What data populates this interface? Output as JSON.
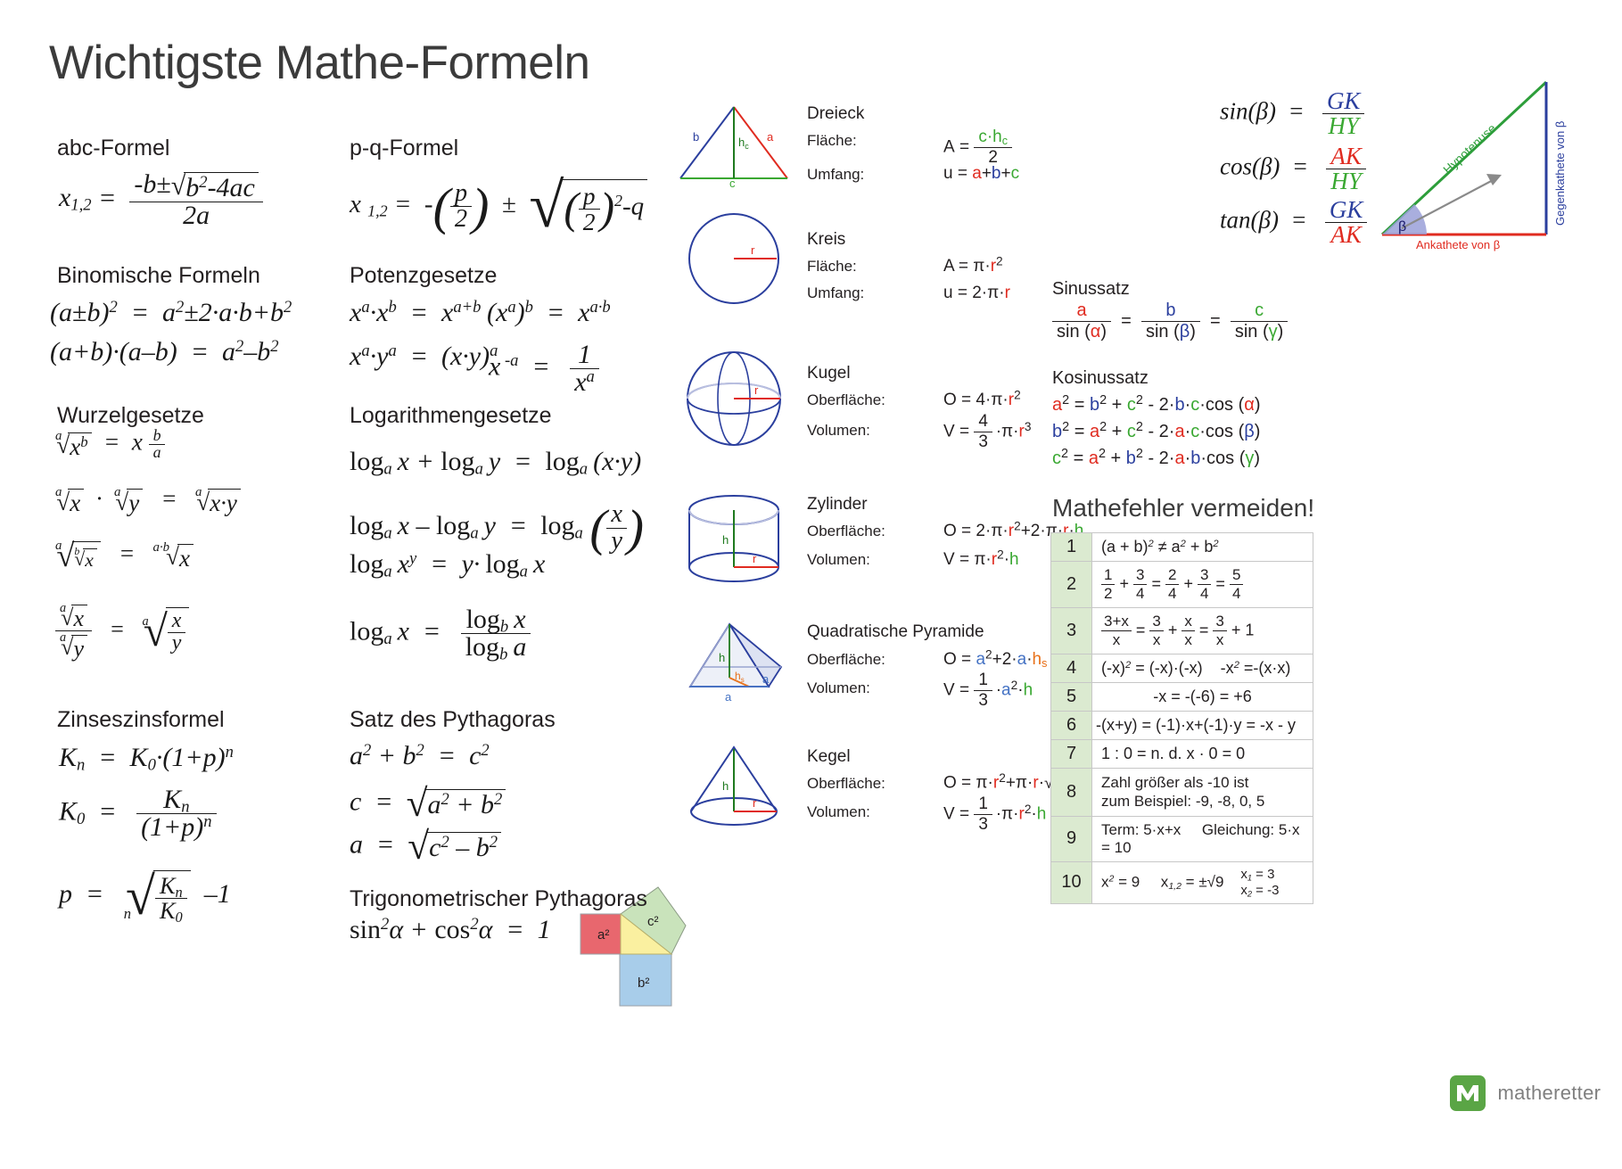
{
  "page": {
    "title": "Wichtigste Mathe-Formeln"
  },
  "sections": {
    "abc": {
      "heading": "abc-Formel"
    },
    "pq": {
      "heading": "p-q-Formel"
    },
    "binom": {
      "heading": "Binomische Formeln"
    },
    "potenz": {
      "heading": "Potenzgesetze"
    },
    "wurzel": {
      "heading": "Wurzelgesetze"
    },
    "log": {
      "heading": "Logarithmengesetze"
    },
    "zins": {
      "heading": "Zinseszinsformel"
    },
    "pyth": {
      "heading": "Satz des Pythagoras"
    },
    "trigpyth": {
      "heading": "Trigonometrischer Pythagoras"
    },
    "sinussatz": {
      "heading": "Sinussatz"
    },
    "kosinussatz": {
      "heading": "Kosinussatz"
    },
    "fehler": {
      "heading": "Mathefehler vermeiden!"
    }
  },
  "pythagoras_diagram": {
    "a_label": "a²",
    "b_label": "b²",
    "c_label": "c²",
    "colors": {
      "a": "#e8676e",
      "b": "#a8cdea",
      "c": "#c9e3bb",
      "triangle": "#faf0a0"
    }
  },
  "shapes": [
    {
      "name": "Dreieck",
      "rows": [
        {
          "label": "Fläche:",
          "lhs": "A"
        },
        {
          "label": "Umfang:",
          "lhs": "u"
        }
      ],
      "diagram_labels": {
        "a": "a",
        "b": "b",
        "c": "c",
        "h": "h",
        "h_sub": "c"
      }
    },
    {
      "name": "Kreis",
      "rows": [
        {
          "label": "Fläche:",
          "lhs": "A"
        },
        {
          "label": "Umfang:",
          "lhs": "u"
        }
      ],
      "diagram_labels": {
        "r": "r"
      }
    },
    {
      "name": "Kugel",
      "rows": [
        {
          "label": "Oberfläche:",
          "lhs": "O"
        },
        {
          "label": "Volumen:",
          "lhs": "V"
        }
      ],
      "diagram_labels": {
        "r": "r"
      }
    },
    {
      "name": "Zylinder",
      "rows": [
        {
          "label": "Oberfläche:",
          "lhs": "O"
        },
        {
          "label": "Volumen:",
          "lhs": "V"
        }
      ],
      "diagram_labels": {
        "r": "r",
        "h": "h"
      }
    },
    {
      "name": "Quadratische Pyramide",
      "rows": [
        {
          "label": "Oberfläche:",
          "lhs": "O"
        },
        {
          "label": "Volumen:",
          "lhs": "V"
        }
      ],
      "diagram_labels": {
        "a": "a",
        "h": "h",
        "hs": "h"
      }
    },
    {
      "name": "Kegel",
      "rows": [
        {
          "label": "Oberfläche:",
          "lhs": "O"
        },
        {
          "label": "Volumen:",
          "lhs": "V"
        }
      ],
      "diagram_labels": {
        "r": "r",
        "h": "h"
      }
    }
  ],
  "trig": {
    "sin_label": "sin(β)",
    "cos_label": "cos(β)",
    "tan_label": "tan(β)",
    "GK": "GK",
    "AK": "AK",
    "HY": "HY",
    "hypotenuse_label": "Hypotenuse",
    "gegenkathete_label": "Gegenkathete von β",
    "ankathete_label": "Ankathete von β",
    "beta": "β"
  },
  "error_table": {
    "rows": [
      {
        "n": "1",
        "text": "(a + b)² ≠ a² + b²"
      },
      {
        "n": "2",
        "text": "1/2 + 3/4 = 2/4 + 3/4 = 5/4"
      },
      {
        "n": "3",
        "text": "(3+x)/x = 3/x + x/x = 3/x + 1"
      },
      {
        "n": "4",
        "text": "(-x)² = (-x)·(-x)     -x² =-(x·x)"
      },
      {
        "n": "5",
        "text": "-x = -(-6) = +6"
      },
      {
        "n": "6",
        "text": "-(x+y) = (-1)·x+(-1)·y = -x - y"
      },
      {
        "n": "7",
        "text": "1 : 0 = n. d.        x · 0 = 0"
      },
      {
        "n": "8",
        "text": "Zahl größer als -10 ist zum Beispiel: -9, -8, 0, 5"
      },
      {
        "n": "9",
        "text": "Term: 5·x+x     Gleichung: 5·x = 10"
      },
      {
        "n": "10",
        "text": "x² = 9     x₁,₂ = ±√9      x₁ = 3   x₂ = -3"
      }
    ]
  },
  "brand": {
    "name": "matheretter",
    "color": "#5aa545"
  }
}
